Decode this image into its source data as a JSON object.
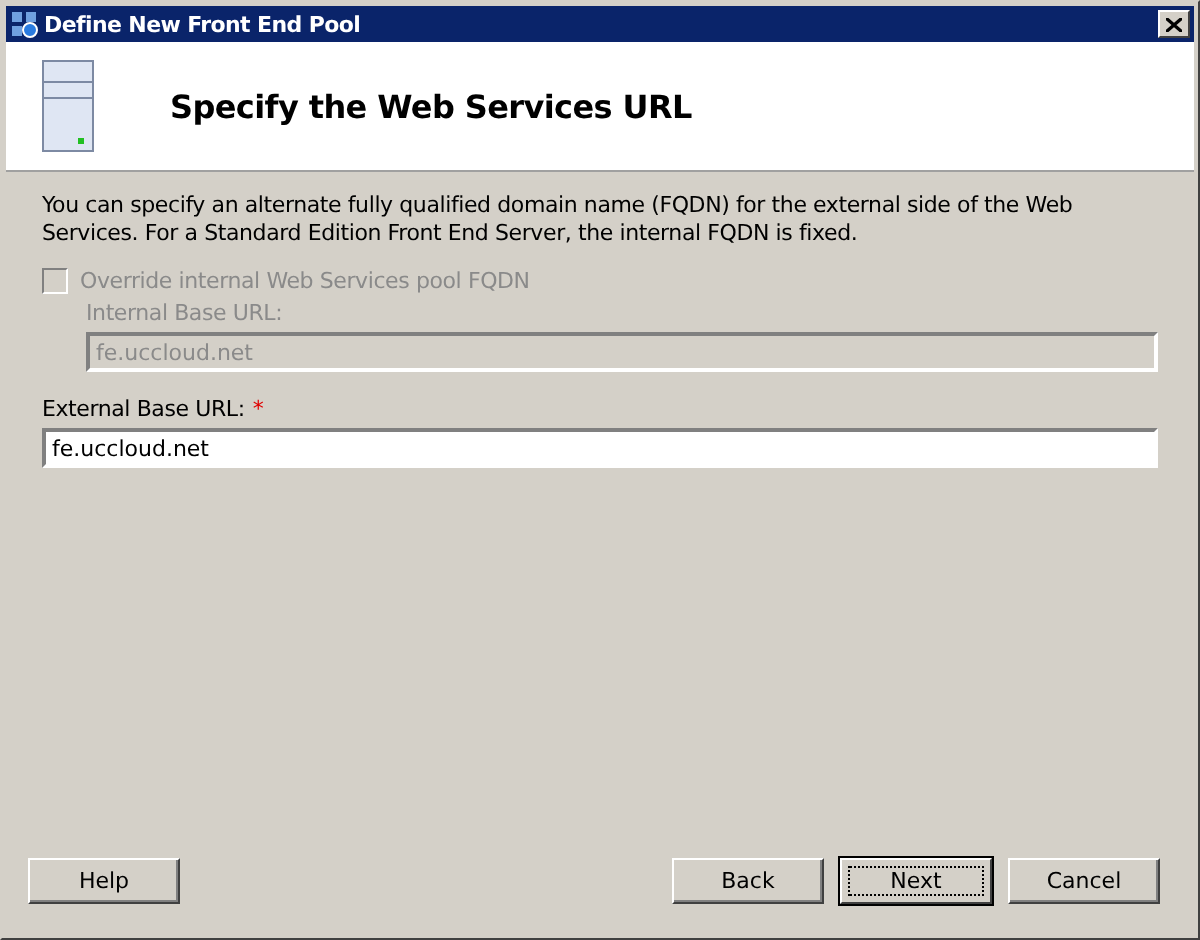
{
  "window": {
    "title": "Define New Front End Pool"
  },
  "header": {
    "title": "Specify the Web Services URL"
  },
  "description": "You can specify an alternate fully qualified domain name (FQDN) for the external side of the Web Services. For a Standard Edition Front End Server, the internal FQDN is fixed.",
  "override": {
    "label": "Override internal Web Services pool FQDN",
    "checked": false,
    "disabled": true
  },
  "internal_url": {
    "label": "Internal Base URL:",
    "value": "fe.uccloud.net",
    "disabled": true
  },
  "external_url": {
    "label": "External Base URL:",
    "required_mark": "*",
    "value": "fe.uccloud.net",
    "disabled": false
  },
  "buttons": [
    {
      "label": "Help",
      "default": false
    },
    {
      "label": "Back",
      "default": false
    },
    {
      "label": "Next",
      "default": true
    },
    {
      "label": "Cancel",
      "default": false
    }
  ]
}
